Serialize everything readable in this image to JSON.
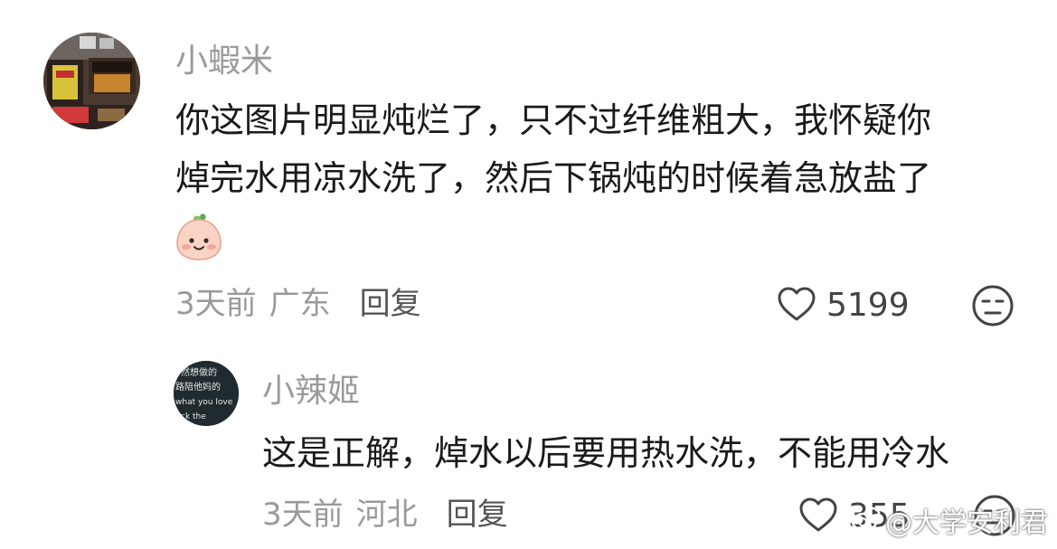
{
  "comments": [
    {
      "author": "小蝦米",
      "lines": [
        "你这图片明显炖烂了，只不过纤维粗大，我怀疑你",
        "焯完水用凉水洗了，然后下锅炖的时候着急放盐了"
      ],
      "time": "3天前",
      "location": "广东",
      "reply_label": "回复",
      "likes": "5199"
    }
  ],
  "reply": {
    "author": "小辣姬",
    "text": "这是正解，焯水以后要用热水洗，不能用冷水",
    "time": "3天前",
    "location": "河北",
    "reply_label": "回复",
    "likes": "355"
  },
  "watermark": {
    "text": "@大学安利君"
  },
  "avatar_reply_text": [
    "然想做的",
    "路陪他妈的",
    "what you love",
    "ck the"
  ],
  "icons": {
    "like": "heart-outline-icon",
    "dislike": "meh-face-icon",
    "emoji": "peach-smile-emoji",
    "watermark": "weibo-logo-icon"
  },
  "colors": {
    "text_primary": "#1a1a1a",
    "text_secondary": "#9a9a9a",
    "reply_button": "#555555",
    "like_count": "#444444",
    "background": "#ffffff"
  }
}
